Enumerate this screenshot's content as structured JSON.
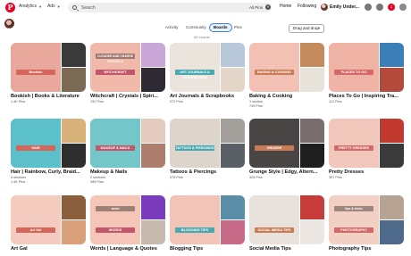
{
  "header": {
    "logo": "P",
    "menu1": "Analytics",
    "menu2": "Ads",
    "search_placeholder": "Search",
    "filter": "All Pins",
    "clear": "×",
    "home": "Home",
    "following": "Following",
    "user": "Emily Under...",
    "notif_count": "1"
  },
  "tabs": [
    "Activity",
    "Community",
    "Boards",
    "Pins"
  ],
  "active_tab": "Boards",
  "board_count": "68 boards",
  "sort_label": "Drag and drop",
  "boards": [
    {
      "title": "Bookish | Books & Literature",
      "sub": "1.4K Pins",
      "banner": "Bookish",
      "colors": [
        "#e8a99c",
        "#3b3a3a",
        "#7c6a55"
      ]
    },
    {
      "title": "Witchcraft | Crystals | Spiri...",
      "sub": "192 Pins",
      "banner": "WITCHCRAFT",
      "banner2": "CLEANSE AND CHARGE CRYSTALS",
      "colors": [
        "#f1b9aa",
        "#c9a7d9",
        "#2d2a33"
      ]
    },
    {
      "title": "Art Journals & Scrapbooks",
      "sub": "572 Pins",
      "banner": "ART JOURNALS & SCRAPBOOKS",
      "colors": [
        "#ebe4dc",
        "#b8c7d9",
        "#e4d6c9"
      ]
    },
    {
      "title": "Baking & Cooking",
      "sub": "1 section\n739 Pins",
      "banner": "BAKING & COOKING",
      "colors": [
        "#f3c1b3",
        "#c48b5c",
        "#e8e3da"
      ]
    },
    {
      "title": "Places To Go | Inspiring Tra...",
      "sub": "112 Pins",
      "banner": "PLACES TO GO",
      "colors": [
        "#f0b4a6",
        "#3a7fb8",
        "#b34a3c"
      ]
    },
    {
      "title": "Hair | Rainbow, Curly, Braid...",
      "sub": "5 sections\n1.4K Pins",
      "banner": "HAIR",
      "colors": [
        "#5bc0c9",
        "#d9b27a",
        "#2e2e2e"
      ]
    },
    {
      "title": "Makeup & Nails",
      "sub": "2 sections\n489 Pins",
      "banner": "MAKEUP & NAILS",
      "colors": [
        "#73c7c9",
        "#e3c9be",
        "#ad7d6d"
      ]
    },
    {
      "title": "Tattoos & Piercings",
      "sub": "375 Pins",
      "banner": "TATTOOS & PIERCINGS",
      "colors": [
        "#ddd4cc",
        "#a3a09b",
        "#5b5f66"
      ]
    },
    {
      "title": "Grunge Style | Edgy, Altern...",
      "sub": "326 Pins",
      "banner": "GRUNGE",
      "colors": [
        "#4a4545",
        "#7a6d6d",
        "#1e1e1e"
      ]
    },
    {
      "title": "Pretty Dresses",
      "sub": "357 Pins",
      "banner": "PRETTY DRESSES",
      "colors": [
        "#f2c7bb",
        "#c23a2f",
        "#3a3a3a"
      ]
    },
    {
      "title": "Art Gal",
      "sub": "",
      "banner": "Art Gal",
      "colors": [
        "#f3cbbf",
        "#8b5e3c",
        "#d9a07a"
      ]
    },
    {
      "title": "Words | Language & Quotes",
      "sub": "",
      "banner": "WORDS",
      "banner2": "weird",
      "colors": [
        "#f5c5b7",
        "#7a3bbd",
        "#c6b9ad"
      ]
    },
    {
      "title": "Blogging Tips",
      "sub": "",
      "banner": "BLOGGING TIPS",
      "colors": [
        "#f2c4b7",
        "#5a8ea8",
        "#c86b88"
      ]
    },
    {
      "title": "Social Media Tips",
      "sub": "",
      "banner": "SOCIAL MEDIA TIPS",
      "colors": [
        "#e8e1dc",
        "#c73b3b",
        "#ede7e4"
      ]
    },
    {
      "title": "Photography Tips",
      "sub": "",
      "banner": "PHOTOGRAPHY",
      "banner2": "tips & tricks",
      "colors": [
        "#f2d0c4",
        "#b7a394",
        "#4d6a8a"
      ]
    }
  ]
}
